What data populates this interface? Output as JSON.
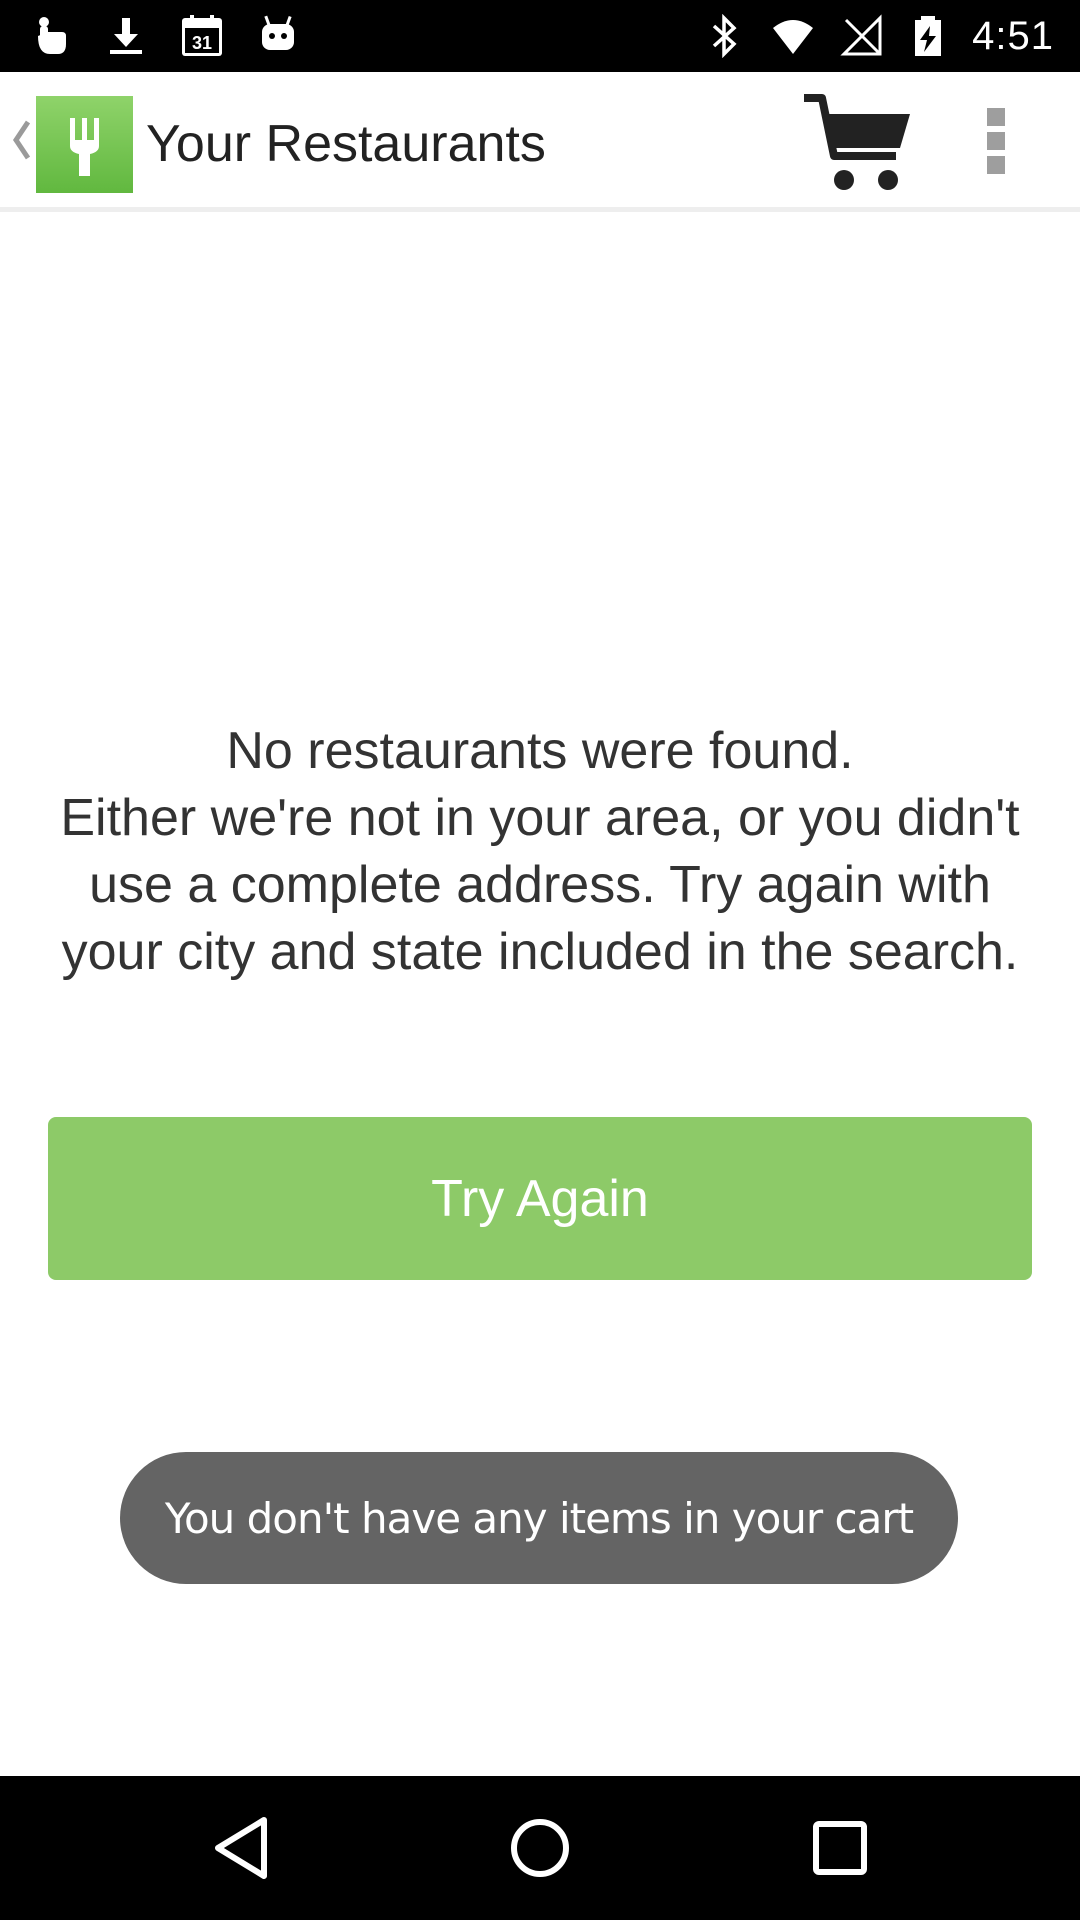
{
  "status_bar": {
    "time": "4:51",
    "left_icons": [
      "touch-icon",
      "download-icon",
      "calendar-icon",
      "android-icon"
    ],
    "calendar_day": "31",
    "right_icons": [
      "bluetooth-icon",
      "wifi-icon",
      "no-signal-icon",
      "battery-charging-icon"
    ]
  },
  "app_bar": {
    "title": "Your Restaurants",
    "logo_icon": "fork-icon",
    "cart_icon": "cart-icon",
    "menu_icon": "overflow-menu-icon",
    "accent_color": "#6cc04a"
  },
  "main": {
    "message_line1": "No restaurants were found.",
    "message_line2": "Either we're not in your area, or you didn't use a complete address. Try again with your city and state included in the search.",
    "try_again_label": "Try Again",
    "button_color": "#8dca68"
  },
  "toast": {
    "text": "You don't have any items in your cart"
  },
  "nav_bar": {
    "icons": [
      "back-icon",
      "home-icon",
      "recents-icon"
    ]
  }
}
